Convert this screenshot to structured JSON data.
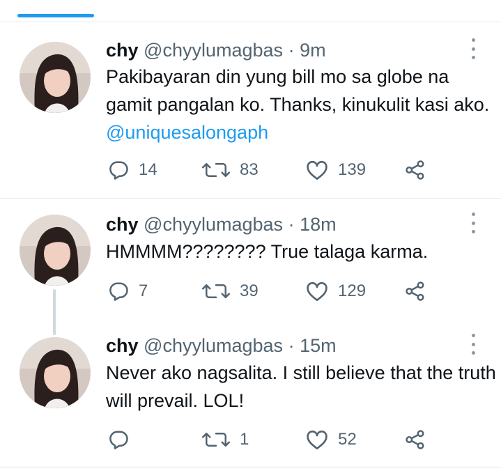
{
  "tweets": [
    {
      "name": "chy",
      "handle": "@chyylumagbas",
      "time": "9m",
      "text_1": "Pakibayaran din yung bill mo sa globe na gamit pangalan ko. Thanks, kinukulit kasi ako.",
      "mention": "@uniquesalongaph",
      "replies": "14",
      "retweets": "83",
      "likes": "139"
    },
    {
      "name": "chy",
      "handle": "@chyylumagbas",
      "time": "18m",
      "text_1": "HMMMM???????? True talaga karma.",
      "replies": "7",
      "retweets": "39",
      "likes": "129"
    },
    {
      "name": "chy",
      "handle": "@chyylumagbas",
      "time": "15m",
      "text_1": "Never ako nagsalita. I still believe that the truth will prevail. LOL!",
      "replies": "",
      "retweets": "1",
      "likes": "52"
    }
  ],
  "separator": "·",
  "icons": [
    "reply-icon",
    "retweet-icon",
    "like-icon",
    "share-icon",
    "more-options-icon"
  ],
  "colors": {
    "accent": "#1d9bf0",
    "text": "#0f1419",
    "muted": "#536471",
    "divider": "#e6e9eb"
  }
}
